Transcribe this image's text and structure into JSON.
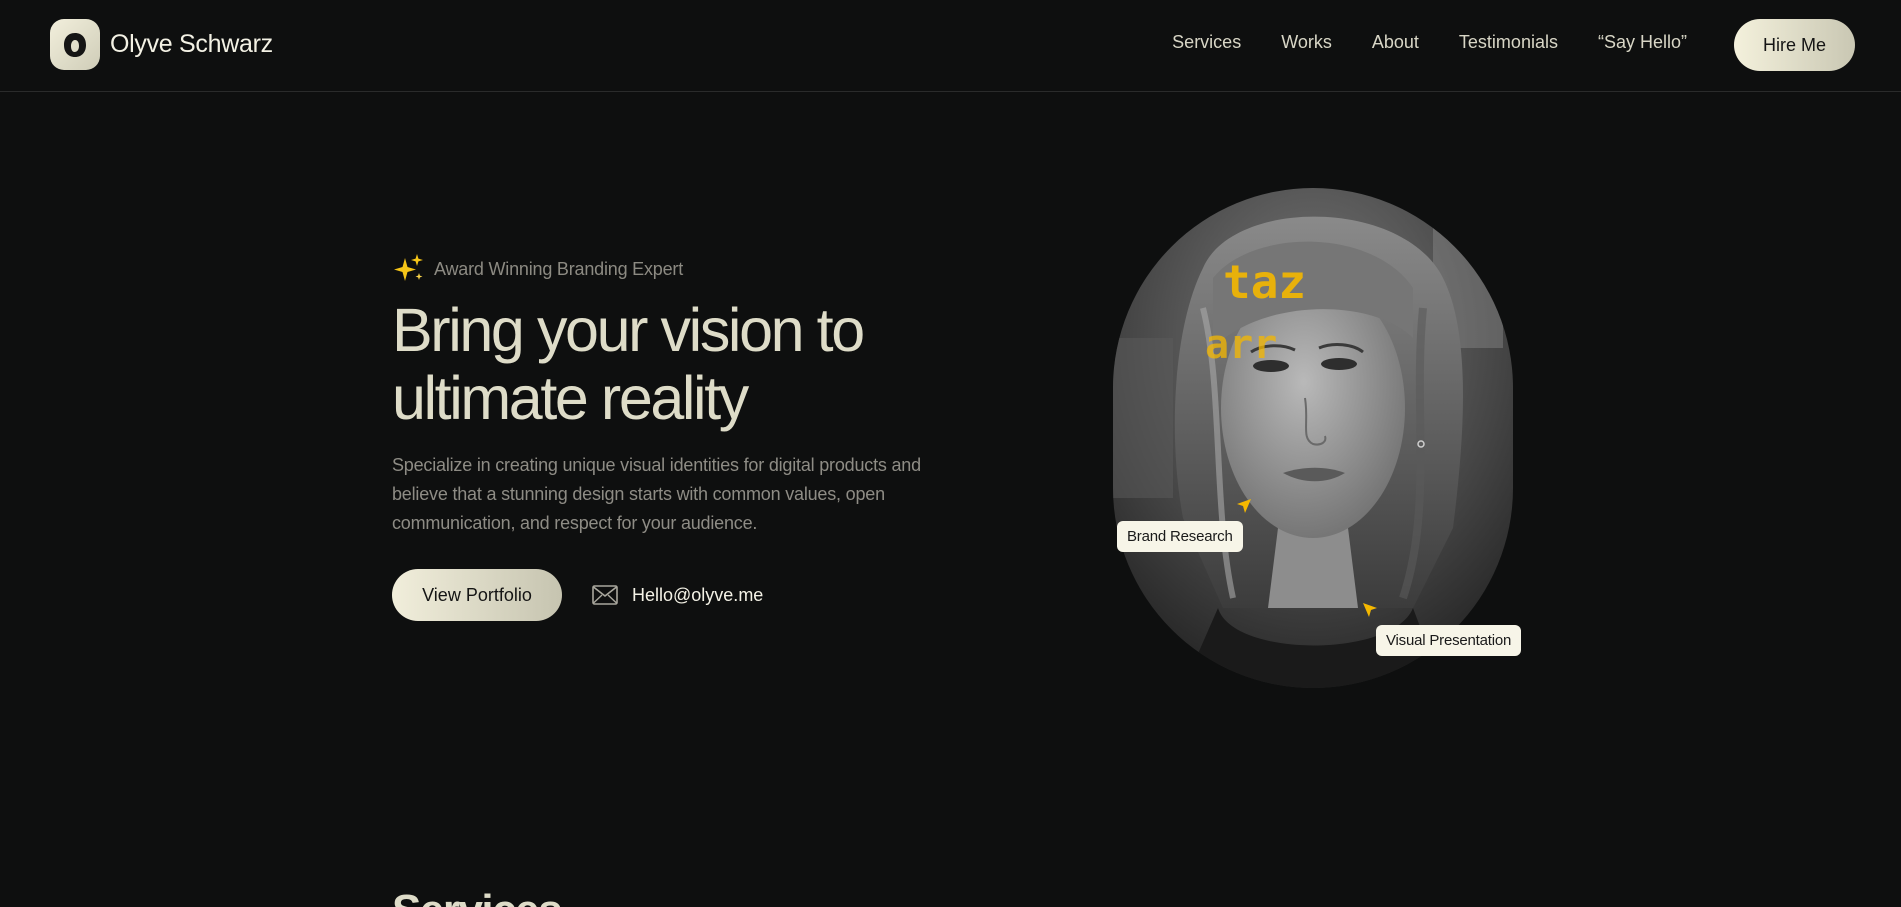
{
  "brand": {
    "name": "Olyve Schwarz",
    "logo_icon": "rounded-o-logo-icon"
  },
  "nav": {
    "items": [
      {
        "label": "Services"
      },
      {
        "label": "Works"
      },
      {
        "label": "About"
      },
      {
        "label": "Testimonials"
      },
      {
        "label": "“Say Hello”"
      }
    ],
    "cta_label": "Hire Me"
  },
  "hero": {
    "eyebrow_icon": "sparkles-icon",
    "eyebrow": "Award Winning Branding Expert",
    "headline_line1": "Bring your vision to",
    "headline_line2": "ultimate reality",
    "description": "Specialize in creating unique visual identities for digital products and believe that a stunning design starts with common values, open communication, and respect for your audience.",
    "portfolio_label": "View Portfolio",
    "email_icon": "envelope-icon",
    "email": "Hello@olyve.me"
  },
  "portrait": {
    "tags": [
      "Brand Research",
      "Visual Presentation"
    ],
    "cursor_icon": "cursor-arrow-icon"
  },
  "next_section": {
    "title": "Services"
  },
  "colors": {
    "background": "#0e0f0f",
    "cream": "#f4f1dc",
    "accent_yellow": "#f5b800",
    "muted_text": "#8e8c85"
  }
}
